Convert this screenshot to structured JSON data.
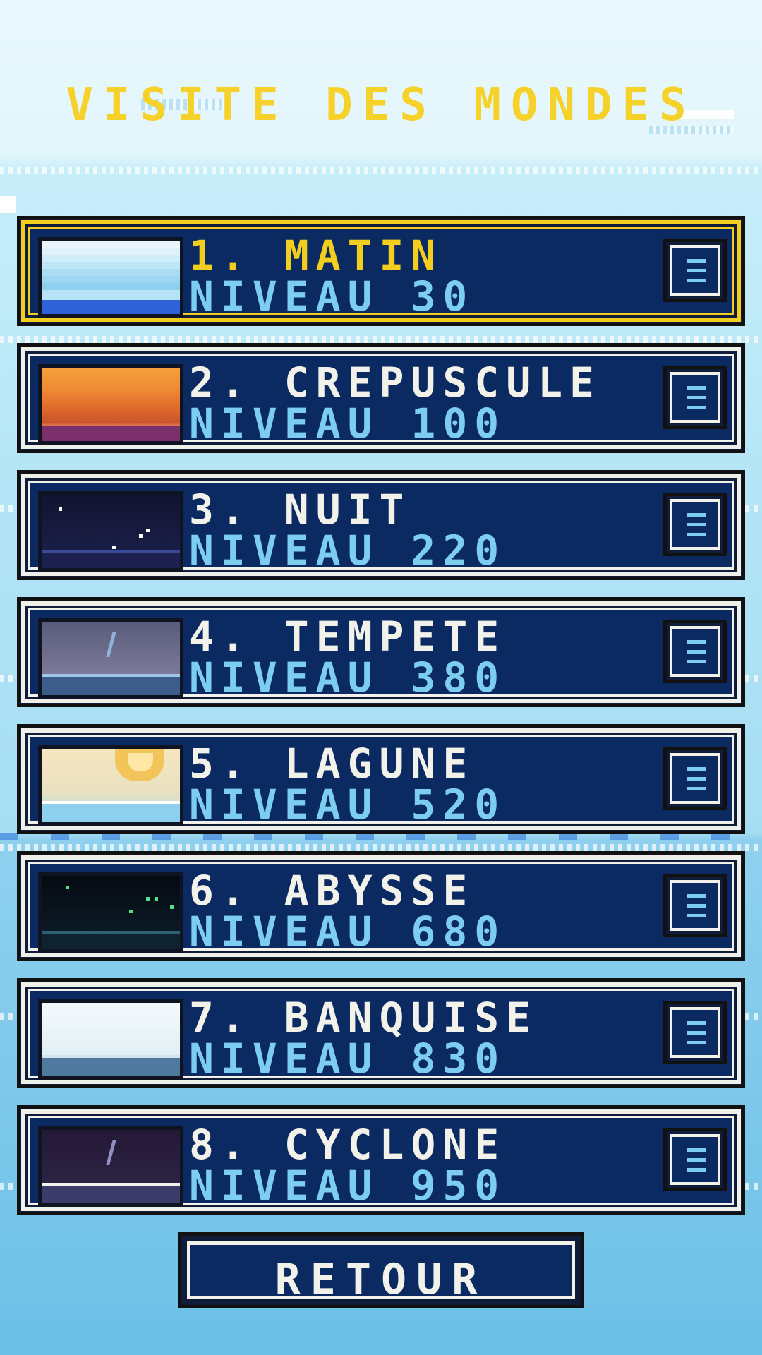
{
  "title": "VISITE DES MONDES",
  "worlds": [
    {
      "name": "1. MATIN",
      "level": "NIVEAU 30",
      "selected": true
    },
    {
      "name": "2. CREPUSCULE",
      "level": "NIVEAU 100",
      "selected": false
    },
    {
      "name": "3. NUIT",
      "level": "NIVEAU 220",
      "selected": false
    },
    {
      "name": "4. TEMPETE",
      "level": "NIVEAU 380",
      "selected": false
    },
    {
      "name": "5. LAGUNE",
      "level": "NIVEAU 520",
      "selected": false
    },
    {
      "name": "6. ABYSSE",
      "level": "NIVEAU 680",
      "selected": false
    },
    {
      "name": "7. BANQUISE",
      "level": "NIVEAU 830",
      "selected": false
    },
    {
      "name": "8. CYCLONE",
      "level": "NIVEAU 950",
      "selected": false
    }
  ],
  "menu_icon": "menu-list-icon",
  "back_label": "RETOUR",
  "colors": {
    "title": "#f6d12a",
    "card_bg": "#0b2a61",
    "selected_border": "#f3ce1e",
    "level_text": "#7ccdf0",
    "name_text": "#f2f2ea"
  }
}
